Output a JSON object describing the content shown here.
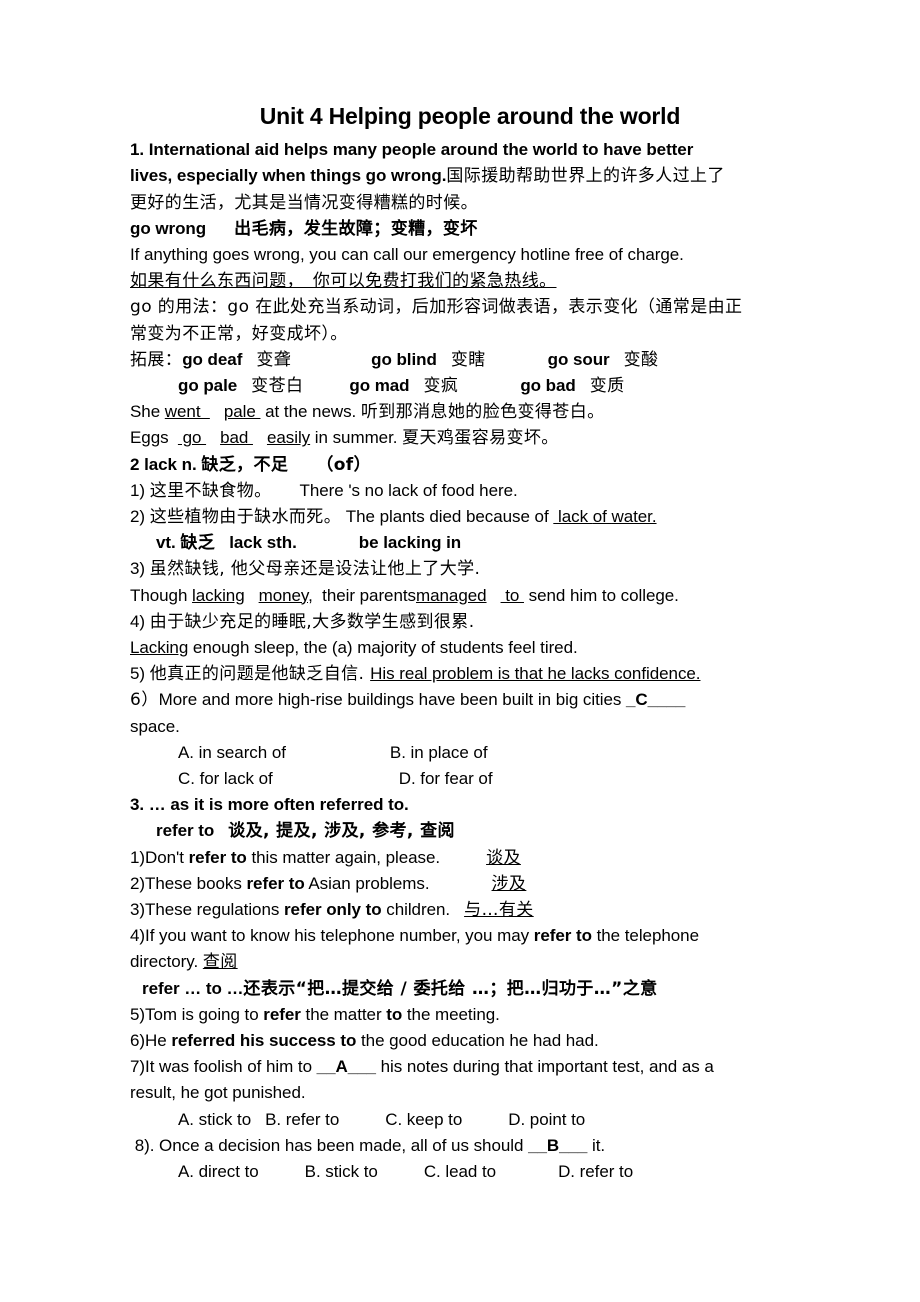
{
  "document": {
    "title": "Unit 4 Helping people around the world",
    "lines": {
      "l01a": "1. International aid helps many people around the world to have better",
      "l02a": "lives, especially when things go wrong.",
      "l02b": "国际援助帮助世界上的许多人过上了",
      "l03": "更好的生活，尤其是当情况变得糟糕的时候。",
      "l04a": "go wrong",
      "l04b": "出毛病，发生故障；变糟，变坏",
      "l05": "If anything goes wrong, you can call our emergency hotline free of charge.",
      "l06": "如果有什么东西问题，　你可以免费打我们的紧急热线。",
      "l07": "go 的用法：go 在此处充当系动词，后加形容词做表语，表示变化（通常是由正",
      "l08": "常变为不正常，好变成坏）。",
      "l09_label": "拓展：",
      "l09_a_en": "go deaf",
      "l09_a_cn": "变聋",
      "l09_b_en": "go blind",
      "l09_b_cn": "变瞎",
      "l09_c_en": "go sour",
      "l09_c_cn": "变酸",
      "l10_a_en": "go pale",
      "l10_a_cn": "变苍白",
      "l10_b_en": "go mad",
      "l10_b_cn": "变疯",
      "l10_c_en": "go bad",
      "l10_c_cn": "变质",
      "l11_pre": "She ",
      "l11_blank1": "went  ",
      "l11_blank2": "pale ",
      "l11_mid": " at the news. ",
      "l11_cn": "听到那消息她的脸色变得苍白。",
      "l12_pre": "Eggs  ",
      "l12_blank1": " go ",
      "l12_blank2": "bad ",
      "l12_blank3": "easily",
      "l12_mid": " in summer. ",
      "l12_cn": "夏天鸡蛋容易变坏。",
      "l13_en1": "2 lack n. ",
      "l13_cn": "缺乏，不足",
      "l13_en2": "（of）",
      "l14_num": "1) ",
      "l14_cn": "这里不缺食物。",
      "l14_en": "There 's no lack of food here.",
      "l15_num": "2) ",
      "l15_cn": "这些植物由于缺水而死。",
      "l15_en1": " The plants died because of ",
      "l15_blank1": " lack ",
      "l15_mid": "of ",
      "l15_blank2": "water.",
      "l16_a": "vt. ",
      "l16_cn": "缺乏",
      "l16_b": "lack sth.",
      "l16_c": "be lacking in",
      "l17_num": "3) ",
      "l17_cn": "虽然缺钱, 他父母亲还是设法让他上了大学.",
      "l18_pre": "Though ",
      "l18_blank1": "lacking",
      "l18_blank2": "money,",
      "l18_mid": "  their parents",
      "l18_blank3": "managed",
      "l18_blank4": " to ",
      "l18_end": " send him to college.",
      "l19_num": "4) ",
      "l19_cn": "由于缺少充足的睡眠,大多数学生感到很累.",
      "l20_blank": "Lacking",
      "l20_rest": " enough sleep, the (a) majority of students feel tired.",
      "l21_num": "5) ",
      "l21_cn": "他真正的问题是他缺乏自信. ",
      "l21_blank": "His real problem is that he lacks confidence.",
      "l22_num": "6）",
      "l22_text": "More and more high-rise buildings have been built in big cities ",
      "l22_answer": "_C____",
      "l23": "space.",
      "l24_a": "A. in search of",
      "l24_b": "B. in place of",
      "l25_c": "C. for lack of",
      "l25_d": "D. for fear of",
      "l26": "3. … as it is more often referred to.",
      "l27_en": "refer to",
      "l27_cn": "谈及, 提及, 涉及, 参考, 查阅",
      "l28_pre": "1)Don't ",
      "l28_b": "refer to",
      "l28_post": " this matter again, please.",
      "l28_cn": "谈及",
      "l29_pre": "2)These books ",
      "l29_b": "refer to",
      "l29_post": " Asian problems.",
      "l29_cn": "涉及",
      "l30_pre": "3)These regulations ",
      "l30_b": "refer only to",
      "l30_post": " children.",
      "l30_cn": "与…有关",
      "l31_pre": "4)If you want to know his telephone number, you may ",
      "l31_b": "refer to",
      "l31_post": " the telephone",
      "l32_pre": "directory. ",
      "l32_cn": "查阅",
      "l33_b": "refer … to …",
      "l33_cn": "还表示“把…提交给 / 委托给 …；把…归功于…”之意",
      "l34_pre": "5)Tom is going to ",
      "l34_b1": "refer",
      "l34_mid": " the matter ",
      "l34_b2": "to",
      "l34_post": " the meeting.",
      "l35_pre": "6)He ",
      "l35_b": "referred his success to",
      "l35_post": " the good education he had had.",
      "l36_pre": "7)It was foolish of him to ",
      "l36_answer": "__A___",
      "l36_post": " his notes during that important test, and as a",
      "l37": "result, he got punished.",
      "l38_a": "A. stick to",
      "l38_b": "B. refer to",
      "l38_c": "C. keep to",
      "l38_d": "D. point to",
      "l39_pre": " 8). Once a decision has been made, all of us should ",
      "l39_answer": "__B___",
      "l39_post": " it.",
      "l40_a": "A. direct to",
      "l40_b": "B. stick to",
      "l40_c": "C. lead to",
      "l40_d": "D. refer to"
    }
  }
}
